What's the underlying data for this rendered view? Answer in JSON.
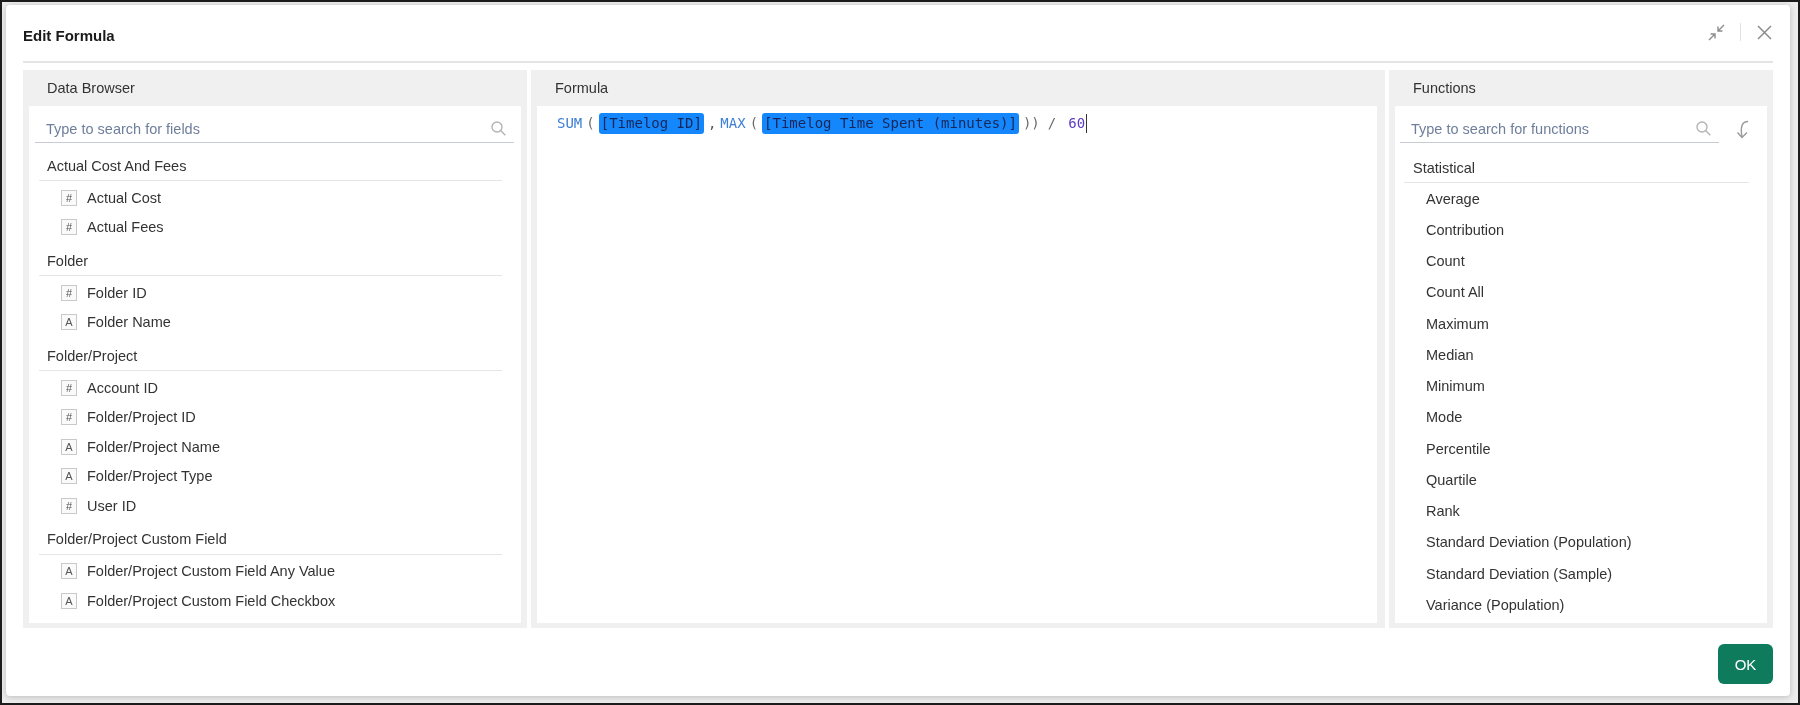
{
  "dialog": {
    "title": "Edit Formula"
  },
  "data_browser": {
    "title": "Data Browser",
    "search": {
      "placeholder": "Type to search for fields"
    },
    "groups": [
      {
        "name": "Actual Cost And Fees",
        "fields": [
          {
            "type_icon": "#",
            "label": "Actual Cost"
          },
          {
            "type_icon": "#",
            "label": "Actual Fees"
          }
        ]
      },
      {
        "name": "Folder",
        "fields": [
          {
            "type_icon": "#",
            "label": "Folder ID"
          },
          {
            "type_icon": "A",
            "label": "Folder Name"
          }
        ]
      },
      {
        "name": "Folder/Project",
        "fields": [
          {
            "type_icon": "#",
            "label": "Account ID"
          },
          {
            "type_icon": "#",
            "label": "Folder/Project ID"
          },
          {
            "type_icon": "A",
            "label": "Folder/Project Name"
          },
          {
            "type_icon": "A",
            "label": "Folder/Project Type"
          },
          {
            "type_icon": "#",
            "label": "User ID"
          }
        ]
      },
      {
        "name": "Folder/Project Custom Field",
        "fields": [
          {
            "type_icon": "A",
            "label": "Folder/Project Custom Field Any Value"
          },
          {
            "type_icon": "A",
            "label": "Folder/Project Custom Field Checkbox"
          }
        ]
      }
    ]
  },
  "formula": {
    "title": "Formula",
    "tokens": [
      {
        "kind": "function",
        "text": "SUM"
      },
      {
        "kind": "paren",
        "text": "("
      },
      {
        "kind": "field",
        "text": "[Timelog ID]"
      },
      {
        "kind": "separator",
        "text": ","
      },
      {
        "kind": "function",
        "text": "MAX"
      },
      {
        "kind": "paren",
        "text": "("
      },
      {
        "kind": "field",
        "text": "[Timelog Time Spent (minutes)]"
      },
      {
        "kind": "paren",
        "text": "))"
      },
      {
        "kind": "operator",
        "text": "/"
      },
      {
        "kind": "number",
        "text": "60"
      }
    ]
  },
  "functions": {
    "title": "Functions",
    "search": {
      "placeholder": "Type to search for functions"
    },
    "groups": [
      {
        "name": "Statistical",
        "items": [
          "Average",
          "Contribution",
          "Count",
          "Count All",
          "Maximum",
          "Median",
          "Minimum",
          "Mode",
          "Percentile",
          "Quartile",
          "Rank",
          "Standard Deviation (Population)",
          "Standard Deviation (Sample)",
          "Variance (Population)"
        ]
      }
    ]
  },
  "footer": {
    "buttons": [
      {
        "label": "OK"
      }
    ]
  }
}
